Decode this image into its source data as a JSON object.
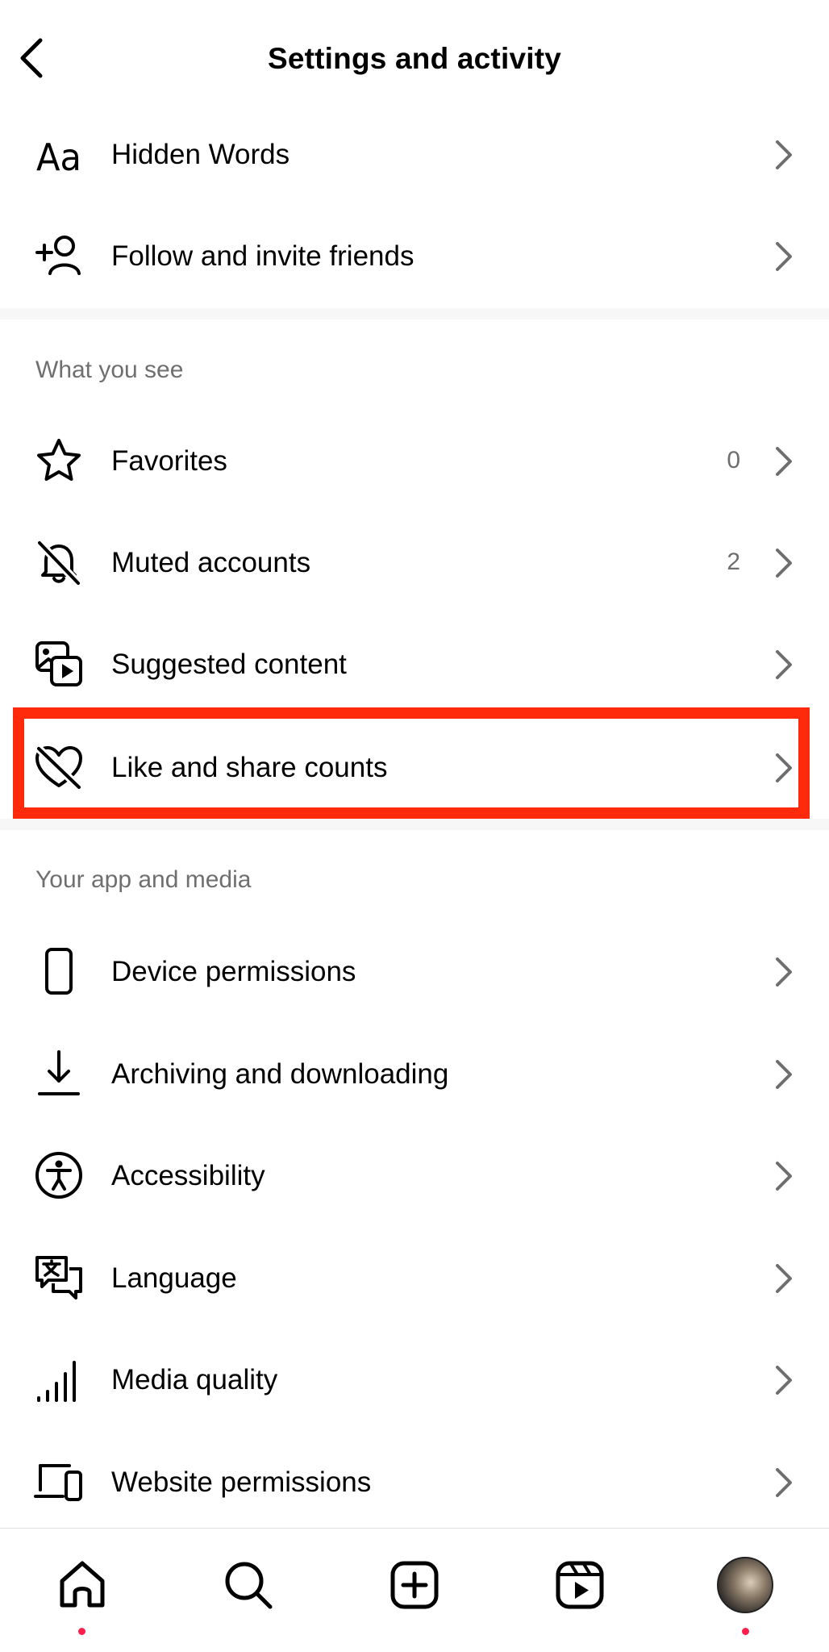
{
  "header": {
    "title": "Settings and activity",
    "back_icon": "chevron-left-icon"
  },
  "top_items": [
    {
      "label": "Hidden Words",
      "icon": "aa-text-icon"
    },
    {
      "label": "Follow and invite friends",
      "icon": "add-person-icon"
    }
  ],
  "sections": [
    {
      "title": "What you see",
      "items": [
        {
          "label": "Favorites",
          "count": "0",
          "icon": "star-icon"
        },
        {
          "label": "Muted accounts",
          "count": "2",
          "icon": "muted-bell-icon"
        },
        {
          "label": "Suggested content",
          "icon": "suggested-media-icon"
        },
        {
          "label": "Like and share counts",
          "icon": "heart-slash-icon",
          "highlighted": true
        }
      ]
    },
    {
      "title": "Your app and media",
      "items": [
        {
          "label": "Device permissions",
          "icon": "phone-icon"
        },
        {
          "label": "Archiving and downloading",
          "icon": "download-icon"
        },
        {
          "label": "Accessibility",
          "icon": "accessibility-icon"
        },
        {
          "label": "Language",
          "icon": "language-bubble-icon"
        },
        {
          "label": "Media quality",
          "icon": "signal-bars-icon"
        },
        {
          "label": "Website permissions",
          "icon": "laptop-phone-icon"
        }
      ]
    }
  ],
  "bottom_nav": [
    {
      "name": "home",
      "icon": "home-icon",
      "notification_dot": true
    },
    {
      "name": "search",
      "icon": "search-icon"
    },
    {
      "name": "create",
      "icon": "plus-square-icon"
    },
    {
      "name": "reels",
      "icon": "reels-icon"
    },
    {
      "name": "profile",
      "icon": "profile-avatar",
      "notification_dot": true
    }
  ],
  "colors": {
    "highlight": "#ff2a0b",
    "notification_dot": "#ff1f4d",
    "secondary_text": "#6f6f6f"
  }
}
